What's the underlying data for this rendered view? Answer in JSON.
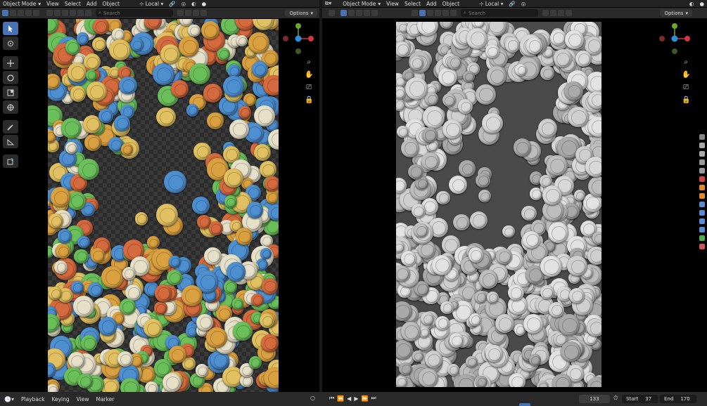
{
  "left_view": {
    "mode": "Object Mode",
    "menu": [
      "View",
      "Select",
      "Add",
      "Object"
    ],
    "orientation": "Local",
    "search_placeholder": "Search",
    "options": "Options"
  },
  "right_view": {
    "mode": "Object Mode",
    "menu": [
      "View",
      "Select",
      "Add",
      "Object"
    ],
    "orientation": "Local",
    "search_placeholder": "Search",
    "options": "Options"
  },
  "gizmo": {
    "x_color": "#d4363f",
    "y_color": "#6fa72a",
    "z_color": "#2c8fdb"
  },
  "tools": [
    "select-box",
    "cursor",
    "move",
    "rotate",
    "scale",
    "transform",
    "annotate",
    "measure",
    "add-cube"
  ],
  "timeline": {
    "menu": [
      "Playback",
      "Keying",
      "View",
      "Marker"
    ],
    "current_frame": "133",
    "start_label": "Start",
    "start": "37",
    "end_label": "End",
    "end": "170"
  },
  "colors": {
    "accent": "#4772b3",
    "coin_palette": [
      "#4e8fd0",
      "#d46a3e",
      "#6bbf5a",
      "#e0c060",
      "#e6e0c8",
      "#d9a040"
    ]
  }
}
